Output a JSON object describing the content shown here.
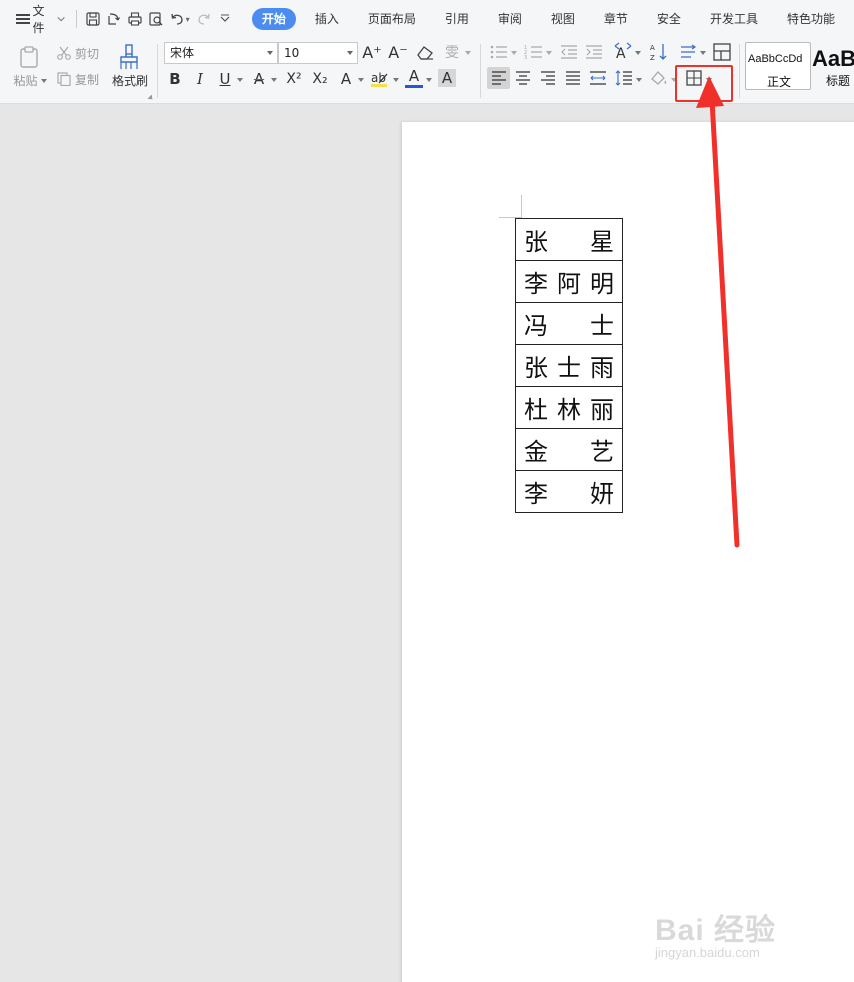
{
  "menubar": {
    "file_label": "文件",
    "tabs": [
      {
        "label": "开始",
        "active": true
      },
      {
        "label": "插入"
      },
      {
        "label": "页面布局"
      },
      {
        "label": "引用"
      },
      {
        "label": "审阅"
      },
      {
        "label": "视图"
      },
      {
        "label": "章节"
      },
      {
        "label": "安全"
      },
      {
        "label": "开发工具"
      },
      {
        "label": "特色功能"
      }
    ]
  },
  "ribbon": {
    "paste_label": "粘贴",
    "cut_label": "剪切",
    "copy_label": "复制",
    "format_painter_label": "格式刷",
    "font_name": "宋体",
    "font_size": "10",
    "bold_label": "B",
    "italic_label": "I",
    "underline_label": "U",
    "strike_label": "A",
    "superscript_label": "X²",
    "subscript_label": "X₂",
    "font_color_label": "A",
    "char_shade_label": "A",
    "text_effect_label": "A",
    "grow_font_label": "A⁺",
    "shrink_font_label": "A⁻",
    "pinyin_label": "雯",
    "styles": [
      {
        "sample": "AaBbCcDd",
        "name": "正文"
      },
      {
        "sample": "AaB",
        "name": "标题"
      }
    ],
    "accent_color": "#4a8cf0",
    "highlight_color": "#f0302a"
  },
  "document": {
    "table_rows": [
      "张星",
      "李阿明",
      "冯士",
      "张士雨",
      "杜林丽",
      "金艺",
      "李妍"
    ]
  },
  "watermark": {
    "main": "Bai 经验",
    "sub": "jingyan.baidu.com"
  }
}
